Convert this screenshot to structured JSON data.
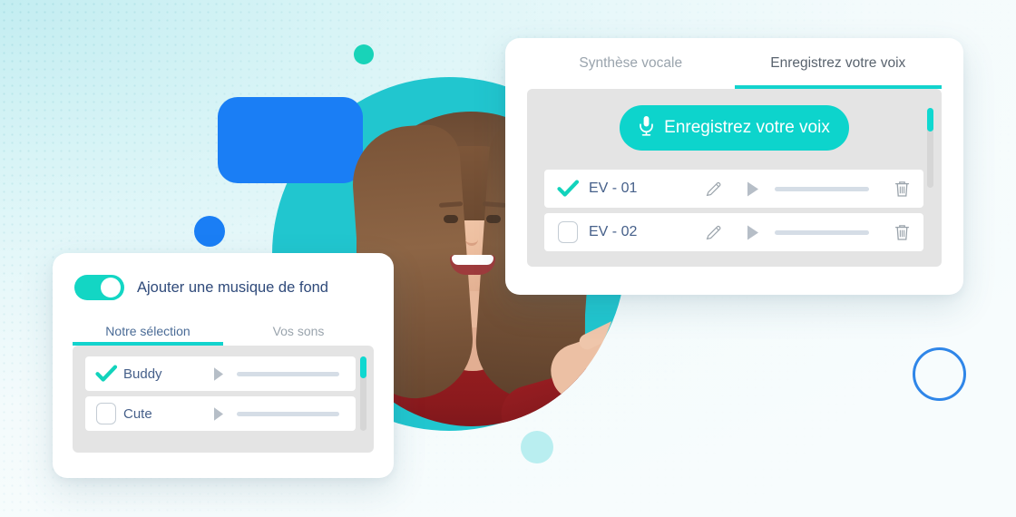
{
  "background": {
    "gradient_from": "#c3edf1",
    "gradient_to": "#f7fcfd",
    "shapes": {
      "teal_blob": "#21c6cf",
      "blue_rect": "#1a7ef5",
      "blue_dot": "#1a7ef5",
      "teal_dot": "#18d3b8",
      "pale_teal_dot": "#b9eef0",
      "blue_ring": "#2f86e8"
    }
  },
  "theme": {
    "accent_teal": "#0dd4cc",
    "text_navy": "#46608a",
    "tab_inactive": "#9aa4ad",
    "panel_gray": "#e4e4e4"
  },
  "recording_panel": {
    "tabs": [
      {
        "label": "Synthèse vocale",
        "active": false
      },
      {
        "label": "Enregistrez votre voix",
        "active": true
      }
    ],
    "record_button": {
      "label": "Enregistrez votre voix",
      "icon": "microphone-icon"
    },
    "rows": [
      {
        "label": "EV - 01",
        "checked": true,
        "icons": [
          "pencil-icon",
          "play-icon",
          "progress-bar",
          "trash-icon"
        ]
      },
      {
        "label": "EV - 02",
        "checked": false,
        "icons": [
          "pencil-icon",
          "play-icon",
          "progress-bar",
          "trash-icon"
        ]
      }
    ],
    "scrollbar": {
      "thumb_color": "#10d8d0",
      "track_color": "#d6d6d6"
    }
  },
  "music_panel": {
    "toggle": {
      "label": "Ajouter une musique de fond",
      "on": true
    },
    "tabs": [
      {
        "label": "Notre sélection",
        "active": true
      },
      {
        "label": "Vos sons",
        "active": false
      }
    ],
    "rows": [
      {
        "label": "Buddy",
        "checked": true,
        "icons": [
          "play-icon",
          "progress-bar"
        ]
      },
      {
        "label": "Cute",
        "checked": false,
        "icons": [
          "play-icon",
          "progress-bar"
        ]
      }
    ],
    "scrollbar": {
      "thumb_color": "#10d8d0",
      "track_color": "#d6d6d6"
    }
  },
  "person": {
    "description": "smiling woman with long brown hair in a red knit sweater pointing to the right"
  }
}
